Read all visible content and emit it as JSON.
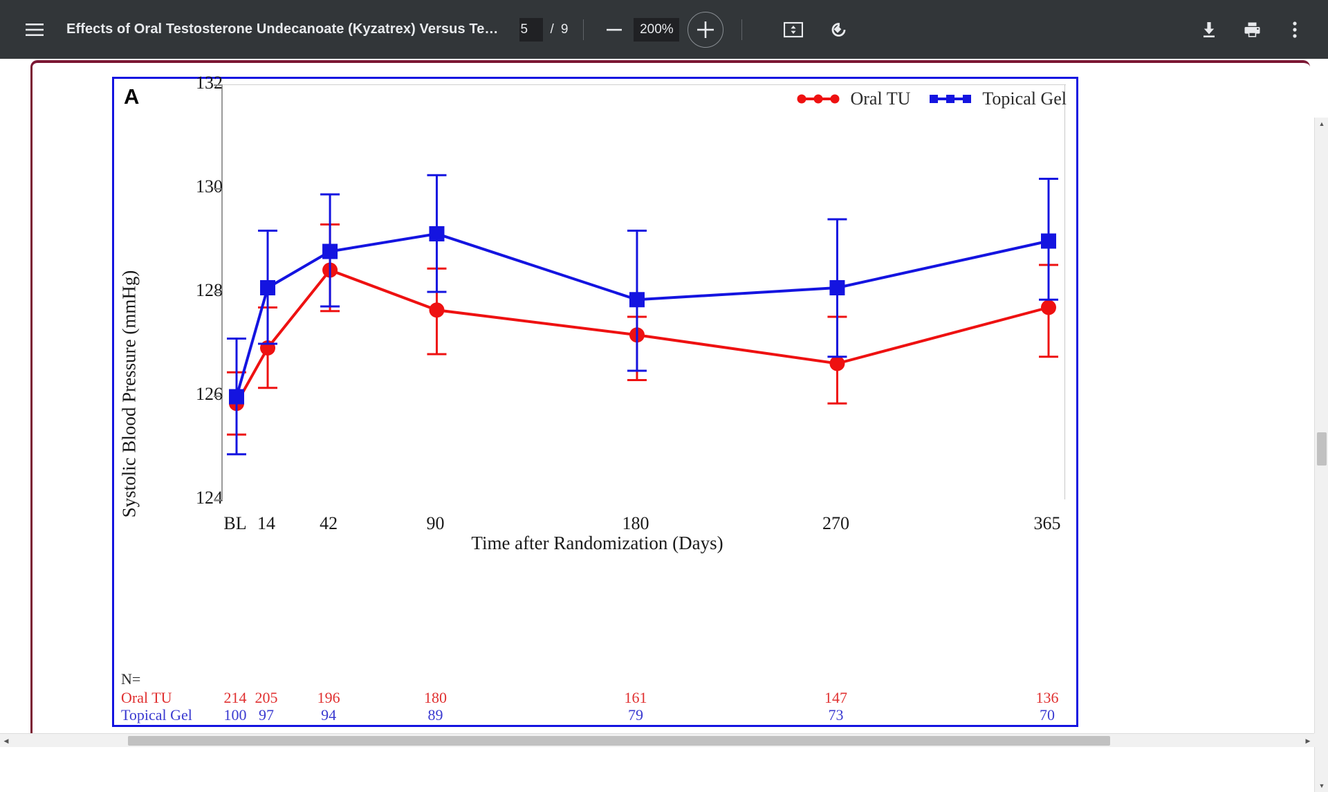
{
  "toolbar": {
    "menu_icon": "hamburger-menu-icon",
    "title": "Effects of Oral Testosterone Undecanoate (Kyzatrex) Versus Te…",
    "page_current": "5",
    "page_separator": "/",
    "page_total": "9",
    "zoom_out_label": "−",
    "zoom_level": "200%",
    "zoom_in_label": "+",
    "fit_icon": "fit-to-page-icon",
    "rotate_icon": "rotate-counterclockwise-icon",
    "download_icon": "download-icon",
    "print_icon": "print-icon",
    "more_icon": "more-vertical-icon",
    "background": "#323639"
  },
  "chart_data": {
    "type": "line",
    "panel_label": "A",
    "title": "",
    "xlabel": "Time after Randomization (Days)",
    "ylabel": "Systolic Blood Pressure (mmHg)",
    "categories": [
      "BL",
      "14",
      "42",
      "90",
      "180",
      "270",
      "365"
    ],
    "x_positions": [
      0,
      14,
      42,
      90,
      180,
      270,
      365
    ],
    "xtick_labels": [
      "BL",
      "14",
      "42",
      "90",
      "180",
      "270",
      "365"
    ],
    "ylim": [
      124,
      132
    ],
    "yticks": [
      124,
      126,
      128,
      130,
      132
    ],
    "ytick_labels": [
      "124",
      "126",
      "128",
      "130",
      "132"
    ],
    "grid": false,
    "legend_position": "top-right",
    "series": [
      {
        "name": "Oral TU",
        "color": "#ee1111",
        "marker": "circle",
        "values": [
          125.85,
          126.92,
          128.42,
          127.65,
          127.17,
          126.62,
          127.7
        ],
        "err_low": [
          125.25,
          126.15,
          127.63,
          126.8,
          126.3,
          125.85,
          126.75
        ],
        "err_high": [
          126.45,
          127.7,
          129.3,
          128.45,
          127.52,
          127.52,
          128.52
        ]
      },
      {
        "name": "Topical Gel",
        "color": "#1414e0",
        "marker": "square",
        "values": [
          125.98,
          128.08,
          128.78,
          129.12,
          127.85,
          128.08,
          128.98
        ],
        "err_low": [
          124.87,
          127.0,
          127.72,
          128.0,
          126.48,
          126.75,
          127.85
        ],
        "err_high": [
          127.1,
          129.18,
          129.88,
          130.25,
          129.18,
          129.4,
          130.18
        ]
      }
    ],
    "n_table": {
      "header": "N=",
      "rows": [
        {
          "label": "Oral TU",
          "color": "#e03030",
          "values": [
            "214",
            "205",
            "196",
            "180",
            "161",
            "147",
            "136"
          ]
        },
        {
          "label": "Topical Gel",
          "color": "#3a3ad0",
          "values": [
            "100",
            "97",
            "94",
            "89",
            "79",
            "73",
            "70"
          ]
        }
      ]
    }
  },
  "scrollbars": {
    "vertical_up": "▲",
    "vertical_down": "▼",
    "horizontal_left": "◀",
    "horizontal_right": "▶"
  }
}
